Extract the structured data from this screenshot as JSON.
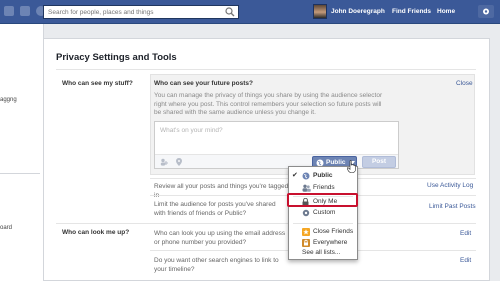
{
  "topbar": {
    "search_placeholder": "Search for people, places and things",
    "user_name": "John Doeregraph",
    "find_friends": "Find Friends",
    "home": "Home"
  },
  "left": {
    "items": [
      "aggng",
      "oard"
    ]
  },
  "page": {
    "title": "Privacy Settings and Tools"
  },
  "sections": {
    "stuff_label": "Who can see my stuff?",
    "look_label": "Who can look me up?"
  },
  "future_posts": {
    "heading": "Who can see your future posts?",
    "close": "Close",
    "description": "You can manage the privacy of things you share by using the audience selector right where you post. This control remembers your selection so future posts will be shared with the same audience unless you change it.",
    "composer_placeholder": "What's on your mind?",
    "audience_button": "Public",
    "post_button": "Post"
  },
  "rows": [
    {
      "text": "Review all your posts and things you're tagged in",
      "action": "Use Activity Log"
    },
    {
      "text": "Limit the audience for posts you've shared with friends of friends or Public?",
      "action": "Limit Past Posts"
    },
    {
      "text": "Who can look you up using the email address or phone number you provided?",
      "action": "Edit"
    },
    {
      "text": "Do you want other search engines to link to your timeline?",
      "action": "Edit"
    }
  ],
  "dropdown": {
    "items": [
      "Public",
      "Friends",
      "Only Me",
      "Custom",
      "Close Friends",
      "Everywhere",
      "See all lists..."
    ],
    "selected": "Public",
    "highlighted": "Only Me"
  },
  "colors": {
    "brand": "#3b5998",
    "highlight": "#c8102e"
  }
}
